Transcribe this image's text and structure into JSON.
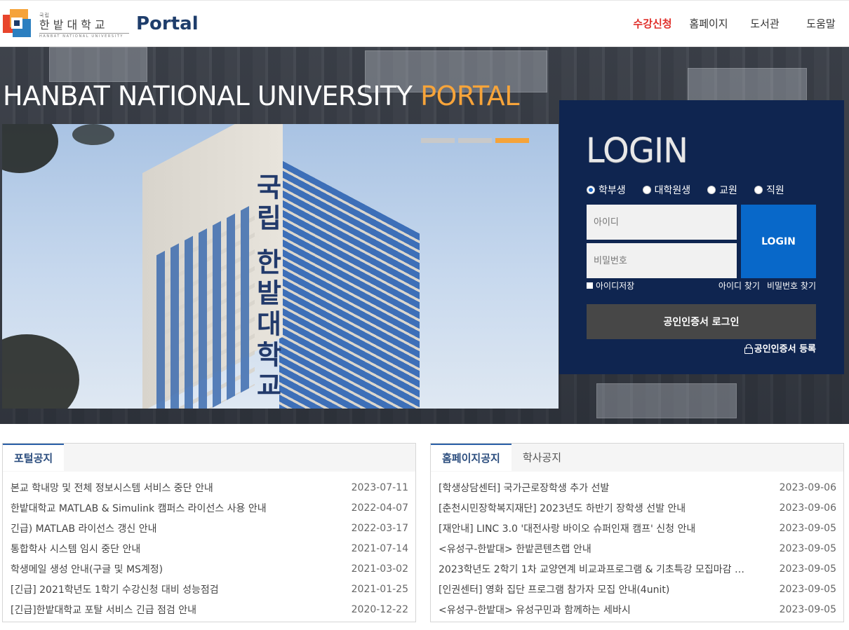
{
  "header": {
    "logo_small": "국립",
    "logo_main": "한밭대학교",
    "logo_sub": "HANBAT NATIONAL UNIVERSITY",
    "portal_word": "Portal",
    "nav": [
      "수강신청",
      "홈페이지",
      "도서관",
      "도움말"
    ]
  },
  "hero": {
    "title_main": "HANBAT NATIONAL UNIVERSITY ",
    "title_accent": "PORTAL",
    "slide_sign": "국립 한밭대학교",
    "slides": 3,
    "active_slide": 3
  },
  "login": {
    "title": "LOGIN",
    "roles": [
      "학부생",
      "대학원생",
      "교원",
      "직원"
    ],
    "selected_role": "학부생",
    "id_placeholder": "아이디",
    "pw_placeholder": "비밀번호",
    "login_button": "LOGIN",
    "save_id": "아이디저장",
    "find_id": "아이디 찾기",
    "find_pw": "비밀번호 찾기",
    "cert_login": "공인인증서 로그인",
    "cert_register": "공인인증서 등록"
  },
  "portal_notice": {
    "tabs": [
      "포털공지"
    ],
    "items": [
      {
        "title": "본교 학내망 및 전체 정보시스템 서비스 중단 안내",
        "date": "2023-07-11"
      },
      {
        "title": "한밭대학교 MATLAB & Simulink 캠퍼스 라이선스 사용 안내",
        "date": "2022-04-07"
      },
      {
        "title": "긴급) MATLAB 라이선스 갱신 안내",
        "date": "2022-03-17"
      },
      {
        "title": "통합학사 시스템 임시 중단 안내",
        "date": "2021-07-14"
      },
      {
        "title": "학생메일 생성 안내(구글 및 MS계정)",
        "date": "2021-03-02"
      },
      {
        "title": "[긴급] 2021학년도 1학기 수강신청 대비 성능점검",
        "date": "2021-01-25"
      },
      {
        "title": "[긴급]한밭대학교 포탈 서비스 긴급 점검 안내",
        "date": "2020-12-22"
      }
    ]
  },
  "home_notice": {
    "tabs": [
      "홈페이지공지",
      "학사공지"
    ],
    "items": [
      {
        "title": "[학생상담센터] 국가근로장학생 추가 선발",
        "date": "2023-09-06"
      },
      {
        "title": "[춘천시민장학복지재단] 2023년도 하반기 장학생 선발 안내",
        "date": "2023-09-06"
      },
      {
        "title": "[재안내] LINC 3.0 '대전사랑 바이오 슈퍼인재 캠프' 신청 안내",
        "date": "2023-09-05"
      },
      {
        "title": "<유성구-한밭대> 한밭콘텐츠랩 안내",
        "date": "2023-09-05"
      },
      {
        "title": "2023학년도 2학기 1차 교양연계 비교과프로그램 & 기초특강 모집마감 …",
        "date": "2023-09-05"
      },
      {
        "title": "[인권센터] 영화 집단 프로그램 참가자 모집 안내(4unit)",
        "date": "2023-09-05"
      },
      {
        "title": "<유성구-한밭대> 유성구민과 함께하는 세바시",
        "date": "2023-09-05"
      }
    ]
  },
  "colors": {
    "navy": "#0f2550",
    "accent_orange": "#f7a43a",
    "login_blue": "#0868c9",
    "nav_active": "#e0302b"
  }
}
